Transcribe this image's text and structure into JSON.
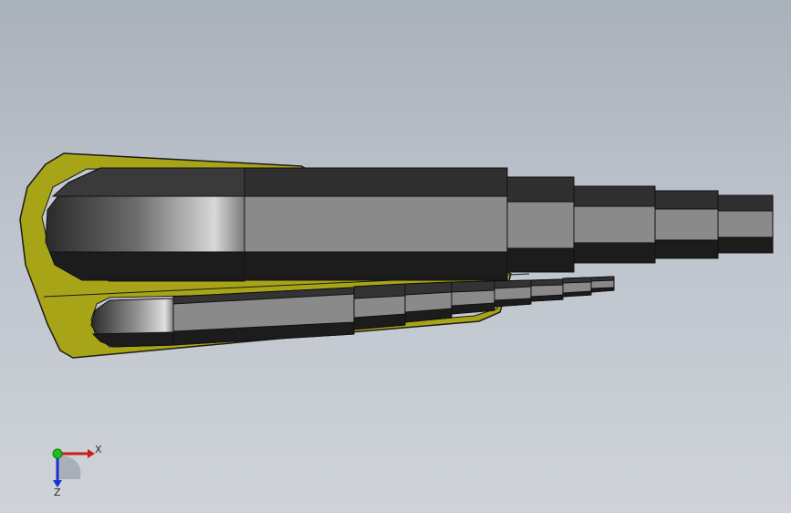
{
  "viewport": {
    "background_top": "#a9b1bc",
    "background_bottom": "#cfd3d9"
  },
  "model": {
    "holder_color": "#a8a418",
    "bit_dark": "#1c1c1c",
    "bit_mid": "#8a8a8a",
    "bit_top": "#3a3a3a"
  },
  "triad": {
    "x_label": "X",
    "z_label": "Z",
    "x_color": "#d11a1a",
    "y_color": "#1fbf1f",
    "z_color": "#1a2fd1"
  }
}
